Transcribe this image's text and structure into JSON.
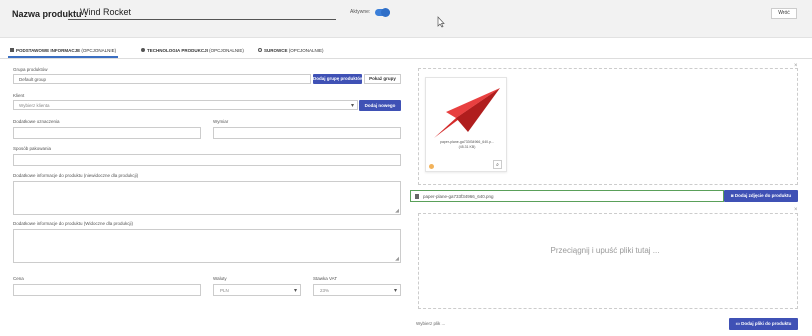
{
  "header": {
    "name_label": "Nazwa produktu :",
    "name_value": "Wind Rocket",
    "active_label": "Aktywne:",
    "back_label": "Wróć"
  },
  "tabs": [
    {
      "label_bold": "PODSTAWOWE INFORMACJE",
      "label_rest": " (OPCJONALNIE)",
      "icon": "lock-icon"
    },
    {
      "label_bold": "TECHNOLOGIA PRODUKCJI",
      "label_rest": " (OPCJONALNIE)",
      "icon": "gear-icon"
    },
    {
      "label_bold": "SUROWCE",
      "label_rest": " (OPCJONALNIE)",
      "icon": "globe-icon"
    }
  ],
  "form": {
    "group_label": "Grupa produktów",
    "group_value": "Default group",
    "add_group_button": "Dodaj grupę produktów",
    "show_groups_button": "Pokaż grupy",
    "client_label": "Klient",
    "client_placeholder": "Wybierz klienta",
    "add_new_button": "Dodaj nowego",
    "extra_mark_label": "Dodatkowe oznaczenia",
    "dimension_label": "Wymiar",
    "packaging_label": "Sposób pakowania",
    "internal_info_label": "Dodatkowe informacje do produktu (niewidoczne dla produkcji)",
    "production_info_label": "Dodatkowe informacje do produktu (Widoczne dla produkcji)",
    "price_label": "Cena",
    "currency_label": "Waluty",
    "currency_value": "PLN",
    "vat_label": "Stawka VAT",
    "vat_value": "23%"
  },
  "images": {
    "thumb_name": "paper-plane-ga733f34966_640.p...",
    "thumb_size": "(45.31 KB)",
    "file_field_value": "paper-plane-ga733f34966_640.png",
    "add_photo_button": "Dodaj zdjęcie do produktu",
    "dropzone_text": "Przeciągnij i upuść pliki tutaj ...",
    "selected_text": "Wybierz plik ...",
    "add_files_button": "Dodaj pliki do produktu"
  },
  "colors": {
    "accent": "#3f51b5",
    "toggle": "#3b7fd9",
    "plane": "#d42a2a"
  }
}
